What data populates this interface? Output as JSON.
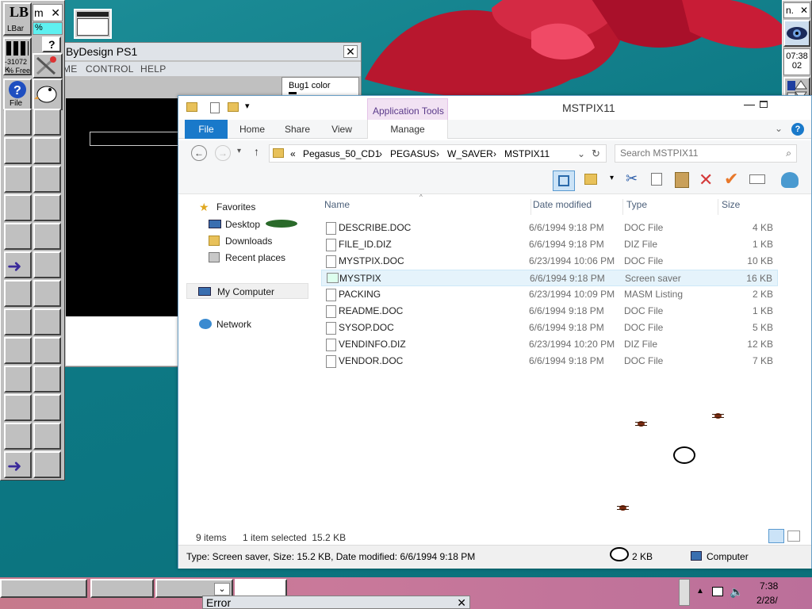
{
  "lbar": {
    "title": "LBar",
    "memory": "-31072 K",
    "memory_unit": "% Free",
    "file_label": "File",
    "partial_label": "m",
    "percent": "%",
    "question": "?"
  },
  "bydesign": {
    "title": "ByDesign PS1",
    "menu": [
      "ME",
      "CONTROL",
      "HELP"
    ],
    "bug_color_label": "Bug1 color"
  },
  "explorer": {
    "title": "MSTPIX11",
    "context_tab": "Application Tools",
    "tabs": [
      "File",
      "Home",
      "Share",
      "View",
      "Manage"
    ],
    "breadcrumb": [
      "Pegasus_50_CD1",
      "PEGASUS",
      "W_SAVER",
      "MSTPIX11"
    ],
    "breadcrumb_sep": "›",
    "breadcrumb_prefix": "«",
    "search_placeholder": "Search MSTPIX11",
    "nav": {
      "favorites": "Favorites",
      "desktop": "Desktop",
      "downloads": "Downloads",
      "recent": "Recent places",
      "computer": "My Computer",
      "network": "Network"
    },
    "columns": [
      "Name",
      "Date modified",
      "Type",
      "Size"
    ],
    "files": [
      {
        "name": "DESCRIBE.DOC",
        "date": "6/6/1994 9:18 PM",
        "type": "DOC File",
        "size": "4 KB"
      },
      {
        "name": "FILE_ID.DIZ",
        "date": "6/6/1994 9:18 PM",
        "type": "DIZ File",
        "size": "1 KB"
      },
      {
        "name": "MYSTPIX.DOC",
        "date": "6/23/1994 10:06 PM",
        "type": "DOC File",
        "size": "10 KB"
      },
      {
        "name": "MYSTPIX",
        "date": "6/6/1994 9:18 PM",
        "type": "Screen saver",
        "size": "16 KB"
      },
      {
        "name": "PACKING",
        "date": "6/23/1994 10:09 PM",
        "type": "MASM Listing",
        "size": "2 KB"
      },
      {
        "name": "README.DOC",
        "date": "6/6/1994 9:18 PM",
        "type": "DOC File",
        "size": "1 KB"
      },
      {
        "name": "SYSOP.DOC",
        "date": "6/6/1994 9:18 PM",
        "type": "DOC File",
        "size": "5 KB"
      },
      {
        "name": "VENDINFO.DIZ",
        "date": "6/23/1994 10:20 PM",
        "type": "DIZ File",
        "size": "12 KB"
      },
      {
        "name": "VENDOR.DOC",
        "date": "6/6/1994 9:18 PM",
        "type": "DOC File",
        "size": "7 KB"
      }
    ],
    "item_count": "9 items",
    "selection": "1 item selected  15.2 KB",
    "details": "Type: Screen saver, Size: 15.2 KB, Date modified: 6/6/1994 9:18 PM",
    "details_size": "2 KB",
    "details_location": "Computer"
  },
  "rbar": {
    "label": "n.",
    "time": "07:38",
    "day": "02"
  },
  "taskbar": {
    "time": "7:38",
    "date": "2/28/"
  },
  "error_window": {
    "title": "Error"
  }
}
